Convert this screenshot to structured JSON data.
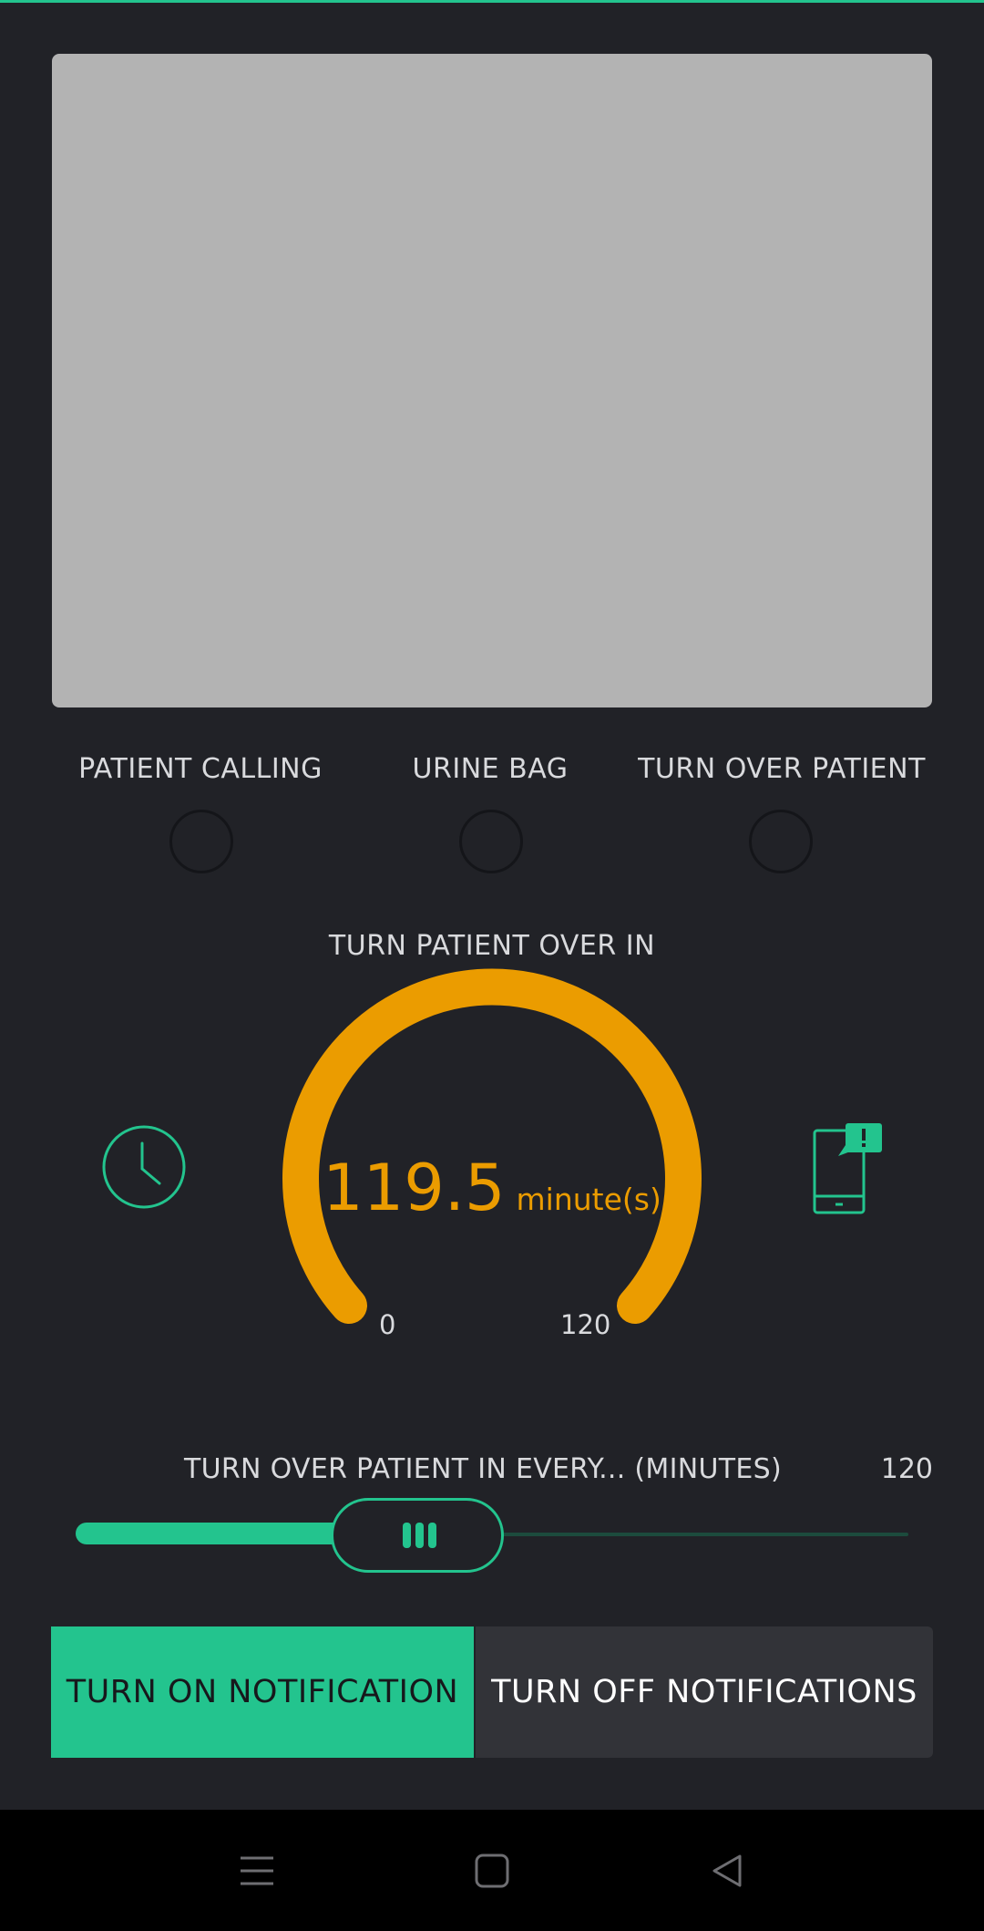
{
  "colors": {
    "background": "#212227",
    "accent_green": "#23c48e",
    "gauge_orange": "#eb9c00",
    "placeholder_gray": "#b3b3b3",
    "button_off_bg": "#323338"
  },
  "leds": [
    {
      "label": "PATIENT CALLING"
    },
    {
      "label": "URINE BAG"
    },
    {
      "label": "TURN OVER PATIENT"
    }
  ],
  "gauge": {
    "label": "TURN PATIENT OVER IN",
    "value": "119.5",
    "unit": "minute(s)",
    "min": "0",
    "max": "120",
    "fill_fraction": 0.996
  },
  "icons": {
    "left": "clock-icon",
    "right": "phone-notification-icon"
  },
  "slider": {
    "label": "TURN OVER PATIENT IN EVERY... (MINUTES)",
    "value": "120"
  },
  "buttons": {
    "on_label": "TURN ON NOTIFICATION",
    "off_label": "TURN OFF NOTIFICATIONS"
  },
  "navbar": {
    "items": [
      "menu-icon",
      "home-icon",
      "back-icon"
    ]
  }
}
